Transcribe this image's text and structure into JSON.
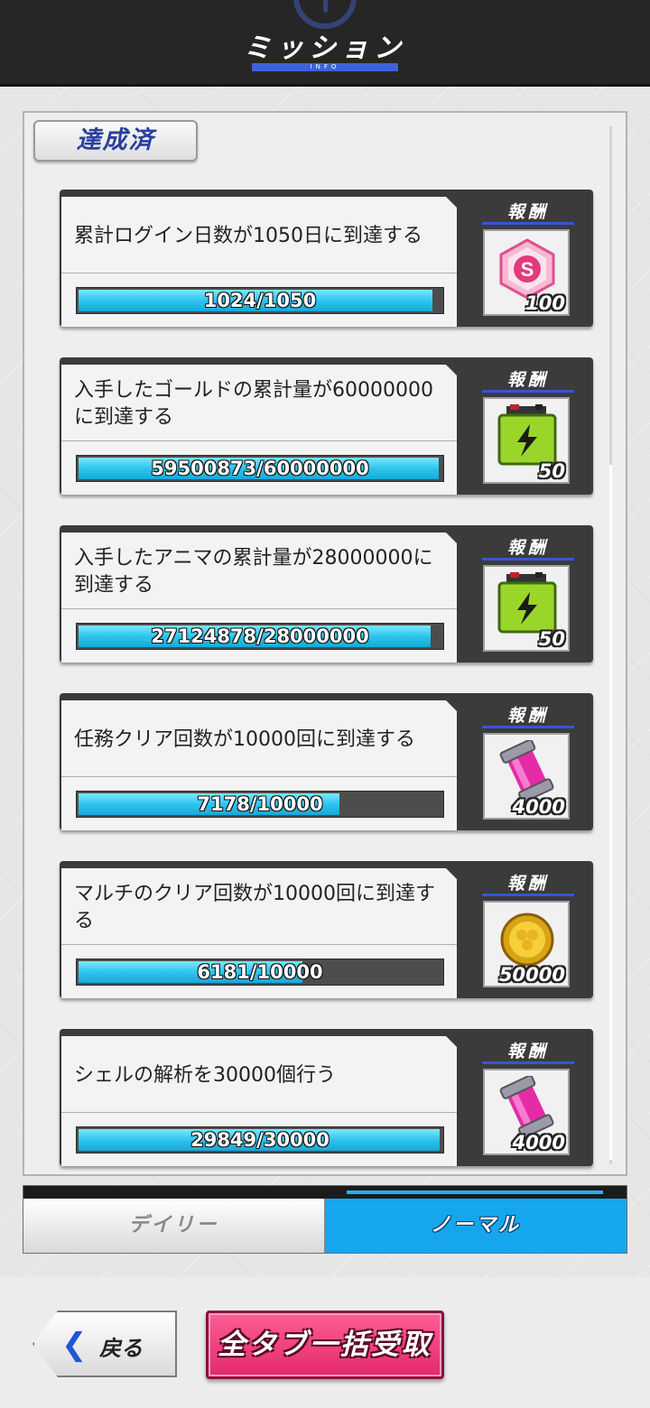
{
  "header": {
    "title": "ミッション",
    "subtitle": "INFO"
  },
  "achieved_tab": {
    "label": "達成済"
  },
  "missions": [
    {
      "description": "累計ログイン日数が1050日に到達する",
      "progress_text": "1024/1050",
      "progress_fraction": 0.975,
      "reward_label": "報酬",
      "reward_icon": "s-crystal-icon",
      "reward_qty": "100"
    },
    {
      "description": "入手したゴールドの累計量が60000000に到達する",
      "progress_text": "59500873/60000000",
      "progress_fraction": 0.992,
      "reward_label": "報酬",
      "reward_icon": "battery-icon",
      "reward_qty": "50"
    },
    {
      "description": "入手したアニマの累計量が28000000に到達する",
      "progress_text": "27124878/28000000",
      "progress_fraction": 0.969,
      "reward_label": "報酬",
      "reward_icon": "battery-icon",
      "reward_qty": "50"
    },
    {
      "description": "任務クリア回数が10000回に到達する",
      "progress_text": "7178/10000",
      "progress_fraction": 0.718,
      "reward_label": "報酬",
      "reward_icon": "pink-capsule-icon",
      "reward_qty": "4000"
    },
    {
      "description": "マルチのクリア回数が10000回に到達する",
      "progress_text": "6181/10000",
      "progress_fraction": 0.618,
      "reward_label": "報酬",
      "reward_icon": "gold-coin-icon",
      "reward_qty": "50000"
    },
    {
      "description": "シェルの解析を30000個行う",
      "progress_text": "29849/30000",
      "progress_fraction": 0.995,
      "reward_label": "報酬",
      "reward_icon": "pink-capsule-icon",
      "reward_qty": "4000"
    }
  ],
  "tabs": {
    "daily": "デイリー",
    "normal": "ノーマル",
    "active": "normal"
  },
  "buttons": {
    "back_arrow": "❮",
    "back": "戻る",
    "claim_all": "全タブ一括受取"
  },
  "colors": {
    "accent_blue": "#16a6ee",
    "progress_cyan": "#2ec4ef",
    "claim_pink": "#e22a6b",
    "title_blue": "#2c3f9e"
  }
}
